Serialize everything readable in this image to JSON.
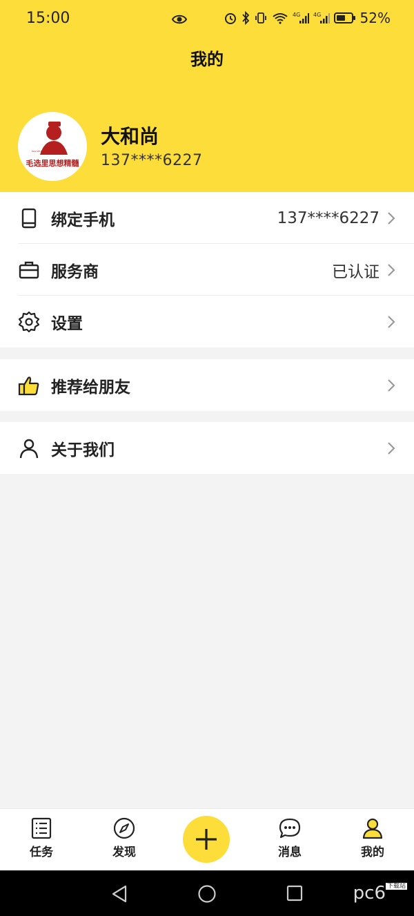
{
  "status_bar": {
    "time": "15:00",
    "battery": "52%",
    "network_label": "4G"
  },
  "header": {
    "title": "我的"
  },
  "profile": {
    "avatar_caption": "毛选里思想精髓",
    "name": "大和尚",
    "phone": "137****6227"
  },
  "menu_group_1": [
    {
      "label": "绑定手机",
      "value": "137****6227",
      "icon": "phone-icon"
    },
    {
      "label": "服务商",
      "value": "已认证",
      "icon": "briefcase-icon"
    },
    {
      "label": "设置",
      "value": "",
      "icon": "gear-icon"
    }
  ],
  "menu_group_2": [
    {
      "label": "推荐给朋友",
      "value": "",
      "icon": "thumbs-up-icon"
    }
  ],
  "menu_group_3": [
    {
      "label": "关于我们",
      "value": "",
      "icon": "user-icon"
    }
  ],
  "tabbar": {
    "tasks": "任务",
    "discover": "发现",
    "messages": "消息",
    "mine": "我的"
  },
  "colors": {
    "accent": "#fddd3a",
    "background": "#f3f3f3"
  },
  "watermark": {
    "text": "pc6",
    "sub": "下载站"
  }
}
